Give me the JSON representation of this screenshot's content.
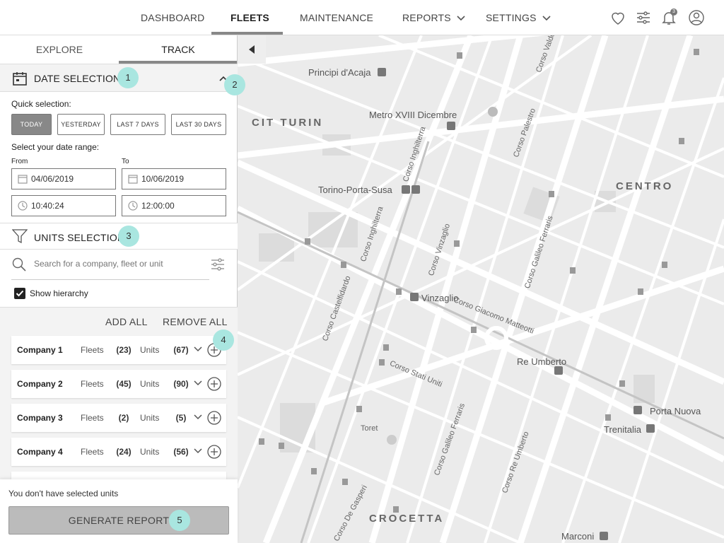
{
  "nav": {
    "items": [
      {
        "label": "DASHBOARD"
      },
      {
        "label": "FLEETS"
      },
      {
        "label": "MAINTENANCE"
      },
      {
        "label": "REPORTS"
      },
      {
        "label": "SETTINGS"
      }
    ],
    "notification_count": "3"
  },
  "panel": {
    "tabs": [
      {
        "label": "EXPLORE"
      },
      {
        "label": "TRACK"
      }
    ],
    "date_section": {
      "title": "DATE SELECTION",
      "badge": "1",
      "collapse_badge": "2",
      "quick_label": "Quick selection:",
      "quick_buttons": [
        "TODAY",
        "YESTERDAY",
        "LAST 7 DAYS",
        "LAST 30 DAYS"
      ],
      "range_label": "Select your date range:",
      "from_label": "From",
      "to_label": "To",
      "from_date": "04/06/2019",
      "to_date": "10/06/2019",
      "from_time": "10:40:24",
      "to_time": "12:00:00"
    },
    "units_section": {
      "title": "UNITS SELECTION",
      "badge": "3",
      "search_placeholder": "Search for a company, fleet or unit",
      "show_hierarchy": "Show hierarchy",
      "add_all": "ADD ALL",
      "remove_all": "REMOVE ALL",
      "list_badge": "4",
      "companies": [
        {
          "name": "Company 1",
          "fleets_label": "Fleets",
          "fleets": "(23)",
          "units_label": "Units",
          "units": "(67)"
        },
        {
          "name": "Company 2",
          "fleets_label": "Fleets",
          "fleets": "(45)",
          "units_label": "Units",
          "units": "(90)"
        },
        {
          "name": "Company 3",
          "fleets_label": "Fleets",
          "fleets": "(2)",
          "units_label": "Units",
          "units": "(5)"
        },
        {
          "name": "Company 4",
          "fleets_label": "Fleets",
          "fleets": "(24)",
          "units_label": "Units",
          "units": "(56)"
        }
      ]
    },
    "footer": {
      "message": "You don't have selected units",
      "button": "GENERATE REPORT",
      "badge": "5"
    }
  },
  "map": {
    "labels": [
      {
        "text": "Principi d'Acaja"
      },
      {
        "text": "CIT TURIN"
      },
      {
        "text": "Metro XVIII Dicembre"
      },
      {
        "text": "Torino-Porta-Susa"
      },
      {
        "text": "CENTRO"
      },
      {
        "text": "Vinzaglio"
      },
      {
        "text": "Re Umberto"
      },
      {
        "text": "Porta Nuova"
      },
      {
        "text": "Trenitalia"
      },
      {
        "text": "Toret"
      },
      {
        "text": "CROCETTA"
      },
      {
        "text": "Marconi"
      },
      {
        "text": "Corso Valdocco"
      },
      {
        "text": "Corso Palestro"
      },
      {
        "text": "Corso Inghilterra"
      },
      {
        "text": "Corso Vinzaglio"
      },
      {
        "text": "Corso Galileo Ferraris"
      },
      {
        "text": "Corso Giacomo Matteotti"
      },
      {
        "text": "Corso Castelfidardo"
      },
      {
        "text": "Corso Stati Uniti"
      },
      {
        "text": "Corso Re Umberto"
      },
      {
        "text": "Corso De Gasperi"
      }
    ]
  }
}
